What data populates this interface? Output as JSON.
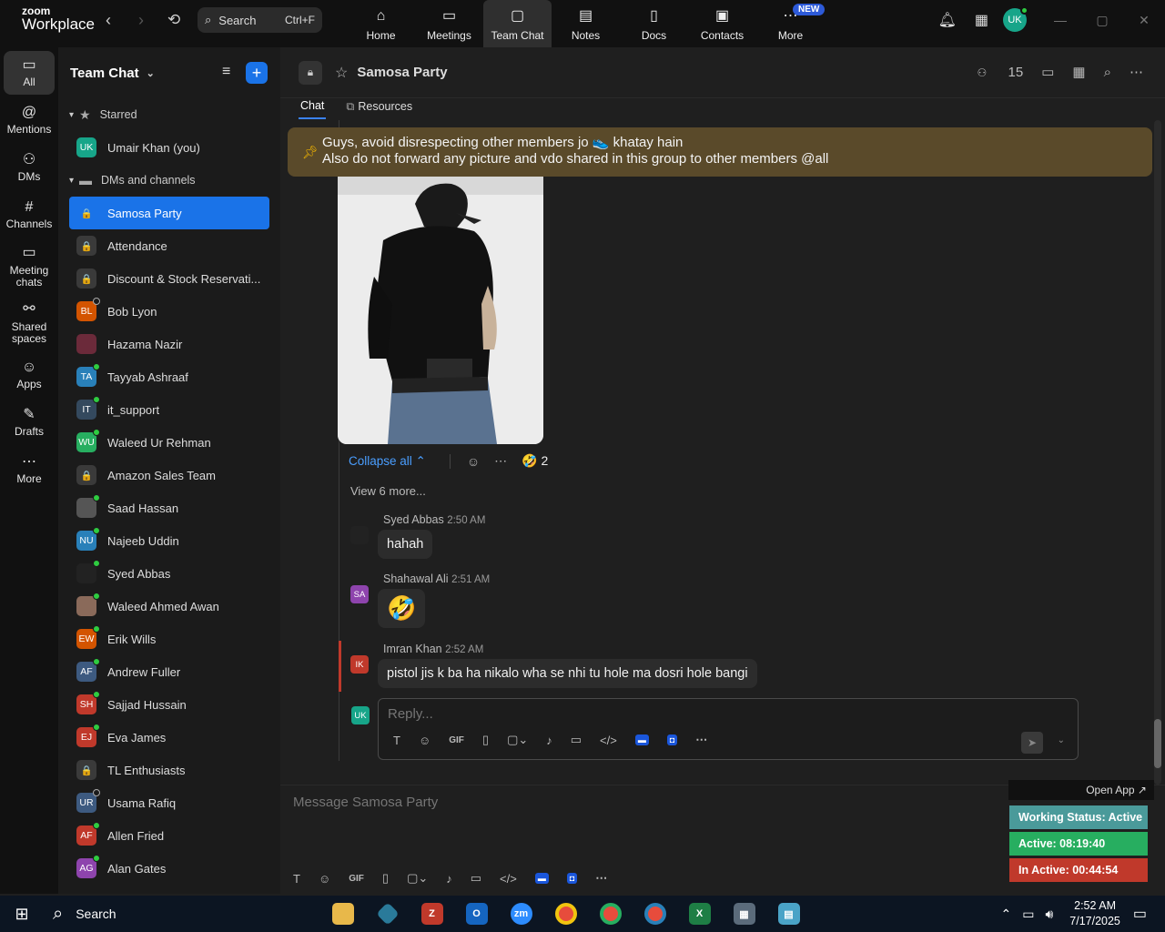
{
  "app": {
    "logo_top": "zoom",
    "logo_bottom": "Workplace"
  },
  "topbar": {
    "search_label": "Search",
    "search_shortcut": "Ctrl+F",
    "nav": [
      {
        "label": "Home",
        "icon": "home-icon"
      },
      {
        "label": "Meetings",
        "icon": "video-icon"
      },
      {
        "label": "Team Chat",
        "icon": "chat-icon"
      },
      {
        "label": "Notes",
        "icon": "notes-icon"
      },
      {
        "label": "Docs",
        "icon": "docs-icon"
      },
      {
        "label": "Contacts",
        "icon": "contacts-icon"
      },
      {
        "label": "More",
        "icon": "more-icon",
        "badge": "NEW"
      }
    ],
    "avatar_initials": "UK"
  },
  "rail": [
    {
      "label": "All"
    },
    {
      "label": "Mentions"
    },
    {
      "label": "DMs"
    },
    {
      "label": "Channels"
    },
    {
      "label": "Meeting chats"
    },
    {
      "label": "Shared spaces"
    },
    {
      "label": "Apps"
    },
    {
      "label": "Drafts"
    },
    {
      "label": "More"
    }
  ],
  "sidebar": {
    "title": "Team Chat",
    "starred_label": "Starred",
    "starred": [
      {
        "name": "Umair Khan (you)",
        "initials": "UK",
        "color": "#17a589"
      }
    ],
    "dms_label": "DMs and channels",
    "items": [
      {
        "name": "Samosa Party",
        "initials": "🔒",
        "color": "#1a73e8",
        "active": true
      },
      {
        "name": "Attendance",
        "initials": "🔒",
        "color": "#3a3a3a"
      },
      {
        "name": "Discount & Stock Reservati...",
        "initials": "🔒",
        "color": "#3a3a3a"
      },
      {
        "name": "Bob Lyon",
        "initials": "BL",
        "color": "#d35400",
        "status": "off"
      },
      {
        "name": "Hazama Nazir",
        "initials": "",
        "color": "#6b2a3a"
      },
      {
        "name": "Tayyab Ashraaf",
        "initials": "TA",
        "color": "#2980b9",
        "status": "on"
      },
      {
        "name": "it_support",
        "initials": "IT",
        "color": "#34495e",
        "status": "on"
      },
      {
        "name": "Waleed Ur Rehman",
        "initials": "WU",
        "color": "#27ae60",
        "status": "on"
      },
      {
        "name": "Amazon Sales Team",
        "initials": "🔒",
        "color": "#3a3a3a"
      },
      {
        "name": "Saad Hassan",
        "initials": "",
        "color": "#555",
        "status": "on"
      },
      {
        "name": "Najeeb Uddin",
        "initials": "NU",
        "color": "#2980b9",
        "status": "on"
      },
      {
        "name": "Syed Abbas",
        "initials": "",
        "color": "#222",
        "status": "on"
      },
      {
        "name": "Waleed Ahmed Awan",
        "initials": "",
        "color": "#8a6a5a",
        "status": "on"
      },
      {
        "name": "Erik Wills",
        "initials": "EW",
        "color": "#d35400",
        "status": "on"
      },
      {
        "name": "Andrew Fuller",
        "initials": "AF",
        "color": "#3d5a80",
        "status": "on"
      },
      {
        "name": "Sajjad Hussain",
        "initials": "SH",
        "color": "#c0392b",
        "status": "on"
      },
      {
        "name": "Eva James",
        "initials": "EJ",
        "color": "#c0392b",
        "status": "on"
      },
      {
        "name": "TL Enthusiasts",
        "initials": "🔒",
        "color": "#3a3a3a"
      },
      {
        "name": "Usama Rafiq",
        "initials": "UR",
        "color": "#3d5a80",
        "status": "off"
      },
      {
        "name": "Allen Fried",
        "initials": "AF",
        "color": "#c0392b",
        "status": "on"
      },
      {
        "name": "Alan Gates",
        "initials": "AG",
        "color": "#8e44ad",
        "status": "on"
      }
    ]
  },
  "channel": {
    "title": "Samosa Party",
    "member_count": "15",
    "tabs": [
      {
        "label": "Chat"
      },
      {
        "label": "Resources"
      }
    ],
    "pinned_line1": "Guys, avoid disrespecting other members jo 👟 khatay hain",
    "pinned_line2": "Also do not forward any picture and vdo shared in this group to other members @all",
    "collapse_label": "Collapse all ⌃",
    "reaction": "🤣 2",
    "view_more": "View 6 more..."
  },
  "messages": [
    {
      "author": "Syed Abbas",
      "time": "2:50 AM",
      "text": "hahah",
      "initials": "",
      "color": "#222"
    },
    {
      "author": "Shahawal Ali",
      "time": "2:51 AM",
      "text": "🤣",
      "initials": "SA",
      "color": "#8e44ad"
    },
    {
      "author": "Imran Khan",
      "time": "2:52 AM",
      "text": "pistol jis k ba ha nikalo wha se nhi tu hole ma dosri hole bangi",
      "initials": "IK",
      "color": "#c0392b"
    }
  ],
  "reply": {
    "placeholder": "Reply...",
    "avatar": "UK"
  },
  "composer": {
    "placeholder": "Message Samosa Party"
  },
  "status_widget": {
    "open_app": "Open App ↗",
    "working": "Working Status: Active",
    "working_color": "#4a9a9a",
    "active": "Active: 08:19:40",
    "active_color": "#27ae60",
    "inactive": "In Active: 00:44:54",
    "inactive_color": "#c0392b"
  },
  "taskbar": {
    "search": "Search",
    "time": "2:52 AM",
    "date": "7/17/2025"
  }
}
